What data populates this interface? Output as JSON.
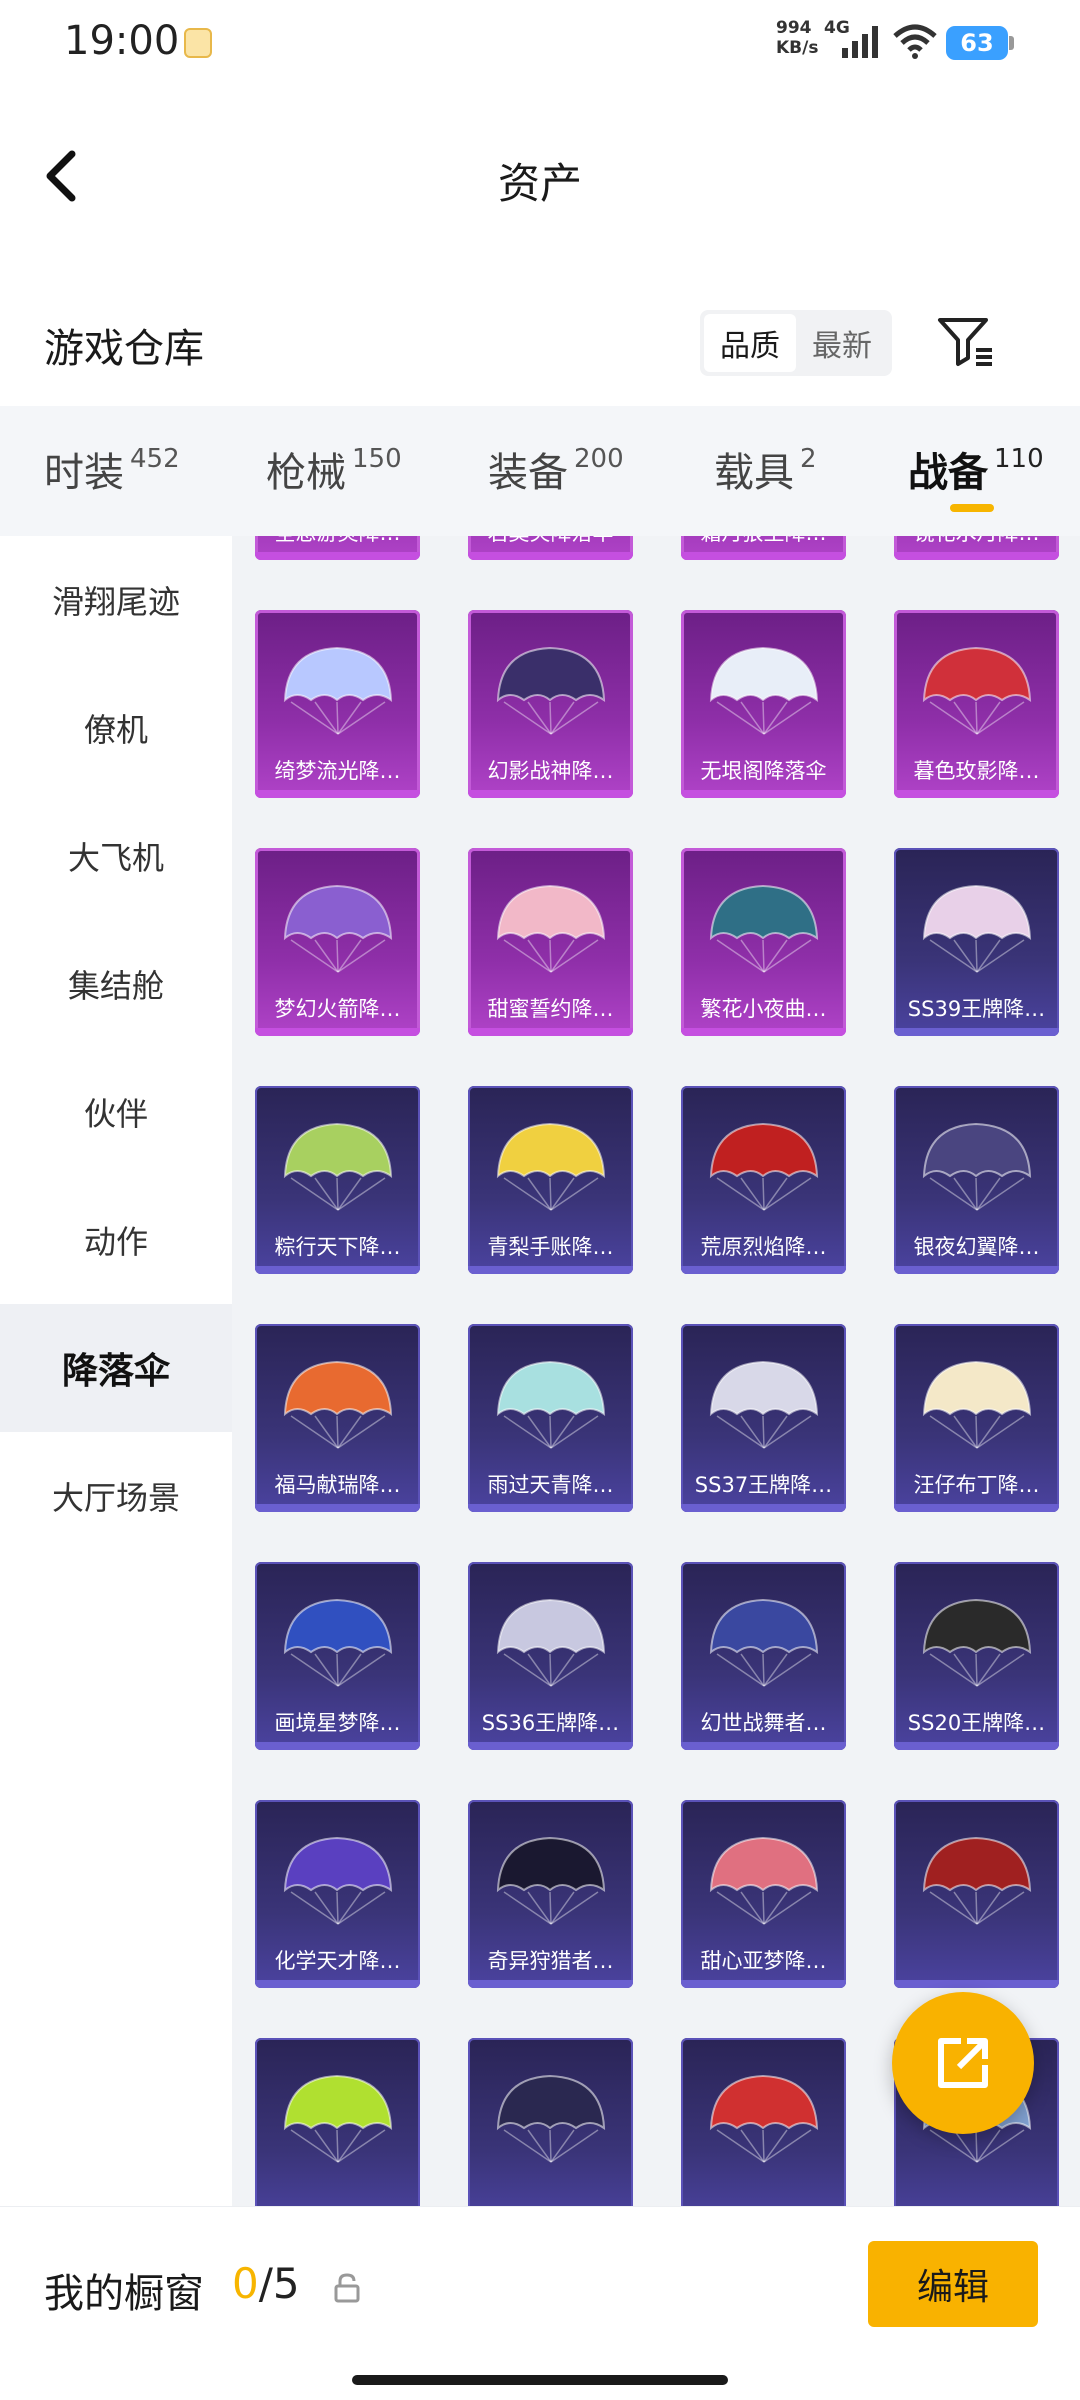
{
  "status_bar": {
    "time": "19:00",
    "speed_value": "994",
    "speed_unit": "KB/s",
    "network": "4G",
    "battery": "63"
  },
  "header": {
    "title": "资产"
  },
  "warehouse": {
    "title": "游戏仓库",
    "sort_options": [
      "品质",
      "最新"
    ],
    "sort_selected": "品质"
  },
  "tabs": [
    {
      "label": "时装",
      "count": "452"
    },
    {
      "label": "枪械",
      "count": "150"
    },
    {
      "label": "装备",
      "count": "200"
    },
    {
      "label": "载具",
      "count": "2"
    },
    {
      "label": "战备",
      "count": "110"
    }
  ],
  "active_tab": "战备",
  "sidebar": {
    "items": [
      "滑翔尾迹",
      "僚机",
      "大飞机",
      "集结舱",
      "伙伴",
      "动作",
      "降落伞",
      "大厅场景"
    ],
    "active": "降落伞"
  },
  "items": [
    {
      "name": "全息游灵降…",
      "rarity": "purple",
      "color": "#d9c8ff"
    },
    {
      "name": "君莫笑降落伞",
      "rarity": "purple",
      "color": "#d0d0e0"
    },
    {
      "name": "霜月狼主降…",
      "rarity": "purple",
      "color": "#c8d8f0"
    },
    {
      "name": "镜花水月降…",
      "rarity": "purple",
      "color": "#e0c8e0"
    },
    {
      "name": "绮梦流光降…",
      "rarity": "purple",
      "color": "#b8c8ff"
    },
    {
      "name": "幻影战神降…",
      "rarity": "purple",
      "color": "#3a2f6a"
    },
    {
      "name": "无垠阁降落伞",
      "rarity": "purple",
      "color": "#e8eef8"
    },
    {
      "name": "暮色玫影降…",
      "rarity": "purple",
      "color": "#d0303a"
    },
    {
      "name": "梦幻火箭降…",
      "rarity": "purple",
      "color": "#8a5fd0"
    },
    {
      "name": "甜蜜誓约降…",
      "rarity": "purple",
      "color": "#f2b8c8"
    },
    {
      "name": "繁花小夜曲…",
      "rarity": "purple",
      "color": "#2f6f86"
    },
    {
      "name": "SS39王牌降…",
      "rarity": "blue",
      "color": "#e8d0e8"
    },
    {
      "name": "粽行天下降…",
      "rarity": "blue",
      "color": "#a8d060"
    },
    {
      "name": "青梨手账降…",
      "rarity": "blue",
      "color": "#f0d040"
    },
    {
      "name": "荒原烈焰降…",
      "rarity": "blue",
      "color": "#c02020"
    },
    {
      "name": "银夜幻翼降…",
      "rarity": "blue",
      "color": "#4a4580"
    },
    {
      "name": "福马献瑞降…",
      "rarity": "blue",
      "color": "#e86a30"
    },
    {
      "name": "雨过天青降…",
      "rarity": "blue",
      "color": "#a8e0e0"
    },
    {
      "name": "SS37王牌降…",
      "rarity": "blue",
      "color": "#d8d8e8"
    },
    {
      "name": "汪仔布丁降…",
      "rarity": "blue",
      "color": "#f4e8c8"
    },
    {
      "name": "画境星梦降…",
      "rarity": "blue",
      "color": "#3050c0"
    },
    {
      "name": "SS36王牌降…",
      "rarity": "blue",
      "color": "#c8c8e0"
    },
    {
      "name": "幻世战舞者…",
      "rarity": "blue",
      "color": "#3a48a0"
    },
    {
      "name": "SS20王牌降…",
      "rarity": "blue",
      "color": "#2a2a2a"
    },
    {
      "name": "化学天才降…",
      "rarity": "blue",
      "color": "#5a40c0"
    },
    {
      "name": "奇异狩猎者…",
      "rarity": "blue",
      "color": "#1a1830"
    },
    {
      "name": "甜心亚梦降…",
      "rarity": "blue",
      "color": "#e07080"
    },
    {
      "name": "",
      "rarity": "blue",
      "color": "#a02020"
    },
    {
      "name": "",
      "rarity": "blue",
      "color": "#b0e030"
    },
    {
      "name": "",
      "rarity": "blue",
      "color": "#2a2850"
    },
    {
      "name": "",
      "rarity": "blue",
      "color": "#d03030"
    },
    {
      "name": "",
      "rarity": "blue",
      "color": "#80a0d0"
    }
  ],
  "showcase": {
    "label": "我的橱窗",
    "current": "0",
    "total": "/5",
    "edit_label": "编辑"
  }
}
